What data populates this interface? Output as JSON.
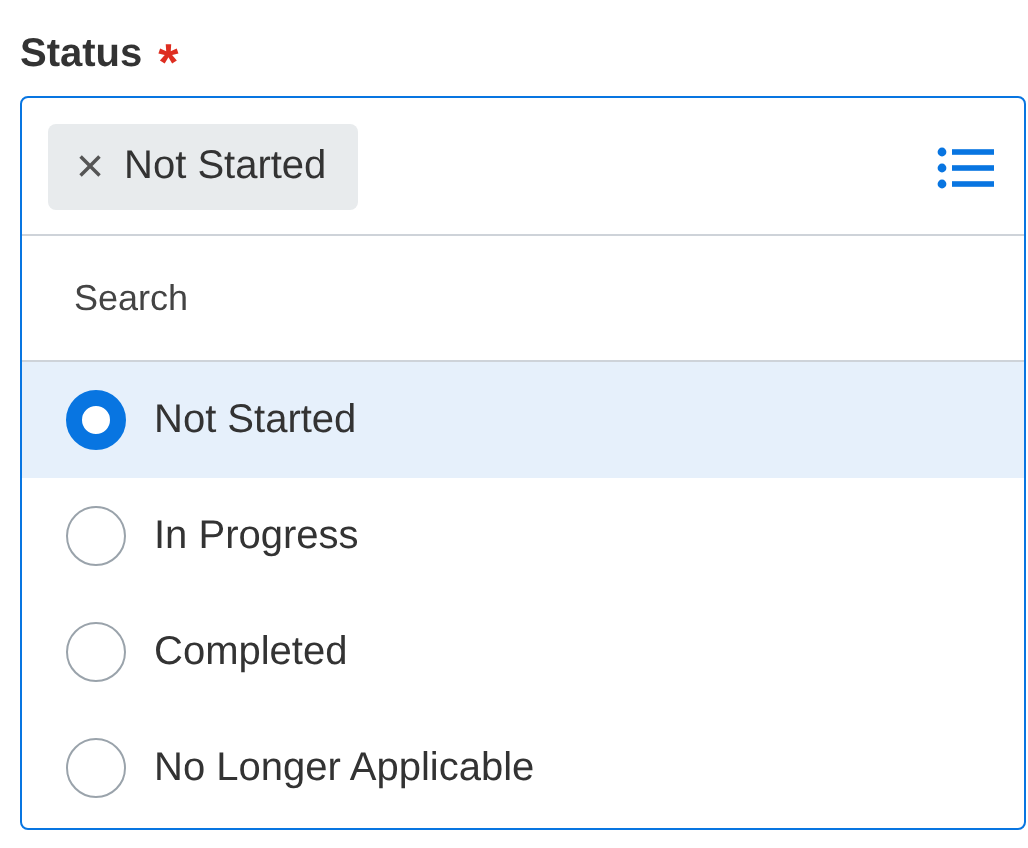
{
  "field": {
    "label": "Status",
    "required_mark": "*"
  },
  "chips": [
    {
      "remove": "×",
      "label": "Not Started"
    }
  ],
  "search": {
    "placeholder": "Search"
  },
  "options": [
    {
      "label": "Not Started",
      "selected": true
    },
    {
      "label": "In Progress",
      "selected": false
    },
    {
      "label": "Completed",
      "selected": false
    },
    {
      "label": "No Longer Applicable",
      "selected": false
    }
  ]
}
